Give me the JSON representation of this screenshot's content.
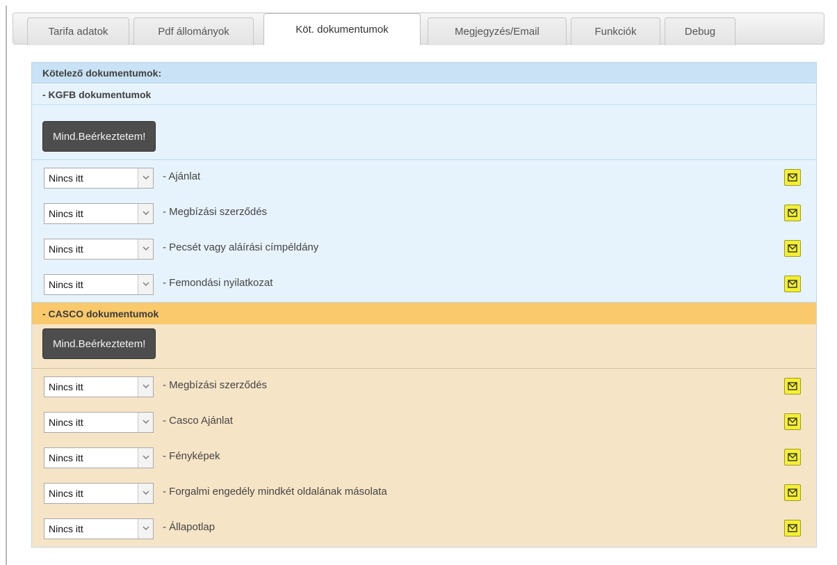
{
  "tabs": [
    {
      "label": "Tarifa adatok",
      "active": false
    },
    {
      "label": "Pdf állományok",
      "active": false
    },
    {
      "label": "Köt. dokumentumok",
      "active": true
    },
    {
      "label": "Megjegyzés/Email",
      "active": false
    },
    {
      "label": "Funkciók",
      "active": false
    },
    {
      "label": "Debug",
      "active": false
    }
  ],
  "panel": {
    "title": "Kötelező dokumentumok:",
    "kgfb": {
      "title": "- KGFB dokumentumok",
      "mark_all_label": "Mind.Beérkeztetem!",
      "documents": [
        {
          "status": "Nincs itt",
          "label": "- Ajánlat"
        },
        {
          "status": "Nincs itt",
          "label": "- Megbízási szerződés"
        },
        {
          "status": "Nincs itt",
          "label": "- Pecsét vagy aláírási címpéldány"
        },
        {
          "status": "Nincs itt",
          "label": "- Femondási nyilatkozat"
        }
      ]
    },
    "casco": {
      "title": "- CASCO dokumentumok",
      "mark_all_label": "Mind.Beérkeztetem!",
      "documents": [
        {
          "status": "Nincs itt",
          "label": "- Megbízási szerződés"
        },
        {
          "status": "Nincs itt",
          "label": "- Casco Ajánlat"
        },
        {
          "status": "Nincs itt",
          "label": "- Fényképek"
        },
        {
          "status": "Nincs itt",
          "label": "- Forgalmi engedély mindkét oldalának másolata"
        },
        {
          "status": "Nincs itt",
          "label": "- Állapotlap"
        }
      ]
    }
  },
  "icons": {
    "select_arrow": "chevron-down-icon",
    "mail_button": "envelope-icon"
  },
  "colors": {
    "kgfb_background": "#e6f3fc",
    "casco_header": "#f9c96b",
    "casco_background": "#f6e4c6",
    "mail_button": "#f4ef34",
    "action_button": "#4d4d4d"
  }
}
